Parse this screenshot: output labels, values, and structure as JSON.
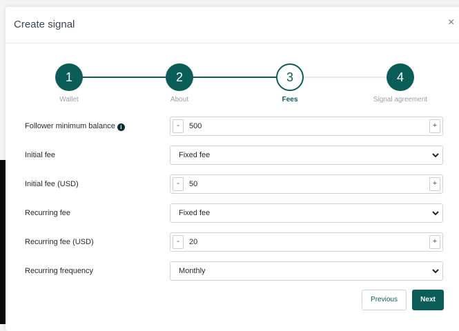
{
  "modal": {
    "title": "Create signal",
    "close_symbol": "×"
  },
  "stepper": {
    "steps": [
      {
        "number": "1",
        "label": "Wallet",
        "state": "completed"
      },
      {
        "number": "2",
        "label": "About",
        "state": "completed"
      },
      {
        "number": "3",
        "label": "Fees",
        "state": "active"
      },
      {
        "number": "4",
        "label": "Signal agreement",
        "state": "pending"
      }
    ]
  },
  "form": {
    "follower_min_balance": {
      "label": "Follower minimum balance",
      "value": "500",
      "info_icon": "info-icon"
    },
    "initial_fee": {
      "label": "Initial fee",
      "value": "Fixed fee"
    },
    "initial_fee_usd": {
      "label": "Initial fee (USD)",
      "value": "50"
    },
    "recurring_fee": {
      "label": "Recurring fee",
      "value": "Fixed fee"
    },
    "recurring_fee_usd": {
      "label": "Recurring fee (USD)",
      "value": "20"
    },
    "recurring_frequency": {
      "label": "Recurring frequency",
      "value": "Monthly"
    },
    "minus_symbol": "-",
    "plus_symbol": "+",
    "info_symbol": "i"
  },
  "buttons": {
    "previous": "Previous",
    "next": "Next"
  },
  "colors": {
    "accent": "#0b5e57"
  }
}
